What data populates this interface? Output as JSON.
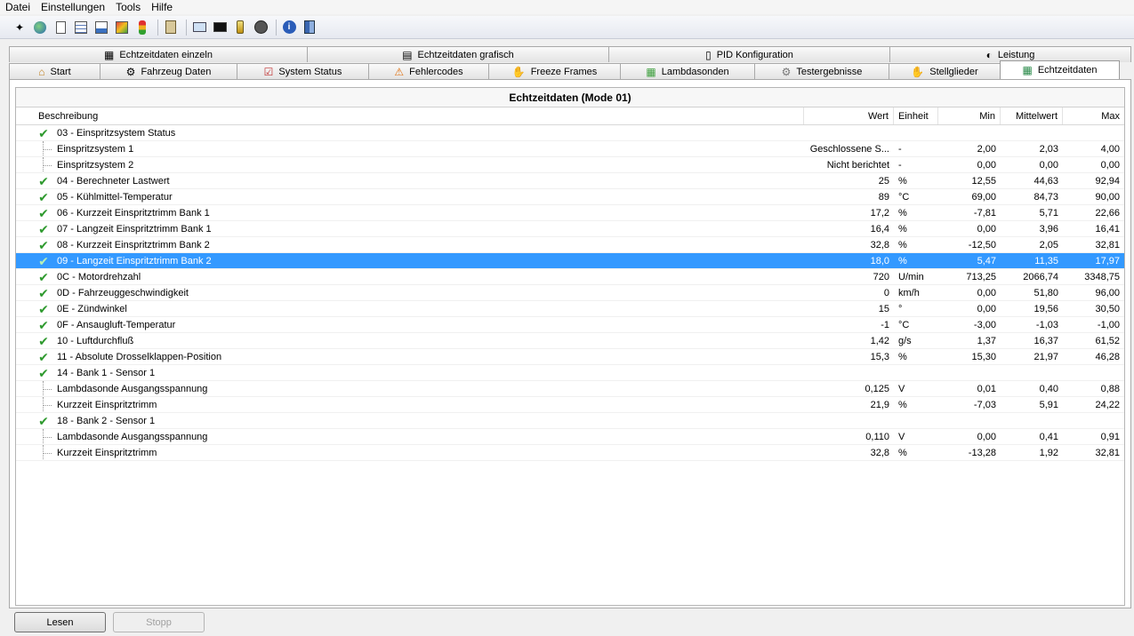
{
  "menu": [
    "Datei",
    "Einstellungen",
    "Tools",
    "Hilfe"
  ],
  "toolbar_icons": [
    "wand-icon",
    "globe-icon",
    "document-icon",
    "grid-icon",
    "chart-icon",
    "colored-chart-icon",
    "traffic-light-icon",
    "sep",
    "clipboard-icon",
    "sep",
    "monitor-icon",
    "terminal-icon",
    "battery-icon",
    "gauge-icon",
    "sep",
    "info-icon",
    "book-icon"
  ],
  "tabs": {
    "row1": [
      {
        "label": "Echtzeitdaten einzeln",
        "icon": "grid-icon"
      },
      {
        "label": "Echtzeitdaten grafisch",
        "icon": "chart-icon"
      },
      {
        "label": "PID Konfiguration",
        "icon": "document-icon"
      },
      {
        "label": "Leistung",
        "icon": "gauge-icon"
      }
    ],
    "row2": [
      {
        "label": "Start",
        "icon": "home-icon"
      },
      {
        "label": "Fahrzeug Daten",
        "icon": "car-icon"
      },
      {
        "label": "System Status",
        "icon": "checklist-icon"
      },
      {
        "label": "Fehlercodes",
        "icon": "warning-icon"
      },
      {
        "label": "Freeze Frames",
        "icon": "hand-icon"
      },
      {
        "label": "Lambdasonden",
        "icon": "sensor-icon"
      },
      {
        "label": "Testergebnisse",
        "icon": "gear-icon"
      },
      {
        "label": "Stellglieder",
        "icon": "hand-icon"
      },
      {
        "label": "Echtzeitdaten",
        "icon": "grid-icon",
        "active": true
      }
    ]
  },
  "table": {
    "title": "Echtzeitdaten (Mode 01)",
    "headers": {
      "desc": "Beschreibung",
      "wert": "Wert",
      "einheit": "Einheit",
      "min": "Min",
      "mittel": "Mittelwert",
      "max": "Max"
    },
    "rows": [
      {
        "level": 0,
        "desc": "03 - Einspritzsystem Status",
        "wert": "",
        "einheit": "",
        "min": "",
        "mittel": "",
        "max": ""
      },
      {
        "level": 1,
        "desc": "Einspritzsystem 1",
        "wert": "Geschlossene S...",
        "einheit": "-",
        "min": "2,00",
        "mittel": "2,03",
        "max": "4,00"
      },
      {
        "level": 1,
        "desc": "Einspritzsystem 2",
        "wert": "Nicht berichtet",
        "einheit": "-",
        "min": "0,00",
        "mittel": "0,00",
        "max": "0,00"
      },
      {
        "level": 0,
        "desc": "04 - Berechneter Lastwert",
        "wert": "25",
        "einheit": "%",
        "min": "12,55",
        "mittel": "44,63",
        "max": "92,94"
      },
      {
        "level": 0,
        "desc": "05 - Kühlmittel-Temperatur",
        "wert": "89",
        "einheit": "°C",
        "min": "69,00",
        "mittel": "84,73",
        "max": "90,00"
      },
      {
        "level": 0,
        "desc": "06 - Kurzzeit Einspritztrimm Bank 1",
        "wert": "17,2",
        "einheit": "%",
        "min": "-7,81",
        "mittel": "5,71",
        "max": "22,66"
      },
      {
        "level": 0,
        "desc": "07 - Langzeit Einspritztrimm Bank 1",
        "wert": "16,4",
        "einheit": "%",
        "min": "0,00",
        "mittel": "3,96",
        "max": "16,41"
      },
      {
        "level": 0,
        "desc": "08 - Kurzzeit Einspritztrimm Bank 2",
        "wert": "32,8",
        "einheit": "%",
        "min": "-12,50",
        "mittel": "2,05",
        "max": "32,81"
      },
      {
        "level": 0,
        "desc": "09 - Langzeit Einspritztrimm Bank 2",
        "wert": "18,0",
        "einheit": "%",
        "min": "5,47",
        "mittel": "11,35",
        "max": "17,97",
        "selected": true
      },
      {
        "level": 0,
        "desc": "0C - Motordrehzahl",
        "wert": "720",
        "einheit": "U/min",
        "min": "713,25",
        "mittel": "2066,74",
        "max": "3348,75"
      },
      {
        "level": 0,
        "desc": "0D - Fahrzeuggeschwindigkeit",
        "wert": "0",
        "einheit": "km/h",
        "min": "0,00",
        "mittel": "51,80",
        "max": "96,00"
      },
      {
        "level": 0,
        "desc": "0E - Zündwinkel",
        "wert": "15",
        "einheit": "°",
        "min": "0,00",
        "mittel": "19,56",
        "max": "30,50"
      },
      {
        "level": 0,
        "desc": "0F - Ansaugluft-Temperatur",
        "wert": "-1",
        "einheit": "°C",
        "min": "-3,00",
        "mittel": "-1,03",
        "max": "-1,00"
      },
      {
        "level": 0,
        "desc": "10 - Luftdurchfluß",
        "wert": "1,42",
        "einheit": "g/s",
        "min": "1,37",
        "mittel": "16,37",
        "max": "61,52"
      },
      {
        "level": 0,
        "desc": "11 - Absolute Drosselklappen-Position",
        "wert": "15,3",
        "einheit": "%",
        "min": "15,30",
        "mittel": "21,97",
        "max": "46,28"
      },
      {
        "level": 0,
        "desc": "14 - Bank 1 - Sensor 1",
        "wert": "",
        "einheit": "",
        "min": "",
        "mittel": "",
        "max": ""
      },
      {
        "level": 1,
        "desc": "Lambdasonde Ausgangsspannung",
        "wert": "0,125",
        "einheit": "V",
        "min": "0,01",
        "mittel": "0,40",
        "max": "0,88"
      },
      {
        "level": 1,
        "desc": "Kurzzeit Einspritztrimm",
        "wert": "21,9",
        "einheit": "%",
        "min": "-7,03",
        "mittel": "5,91",
        "max": "24,22"
      },
      {
        "level": 0,
        "desc": "18 - Bank 2 - Sensor 1",
        "wert": "",
        "einheit": "",
        "min": "",
        "mittel": "",
        "max": ""
      },
      {
        "level": 1,
        "desc": "Lambdasonde Ausgangsspannung",
        "wert": "0,110",
        "einheit": "V",
        "min": "0,00",
        "mittel": "0,41",
        "max": "0,91"
      },
      {
        "level": 1,
        "desc": "Kurzzeit Einspritztrimm",
        "wert": "32,8",
        "einheit": "%",
        "min": "-13,28",
        "mittel": "1,92",
        "max": "32,81"
      }
    ]
  },
  "buttons": {
    "read": "Lesen",
    "stop": "Stopp"
  },
  "colors": {
    "selection": "#3399ff",
    "check": "#2f9a2f"
  }
}
